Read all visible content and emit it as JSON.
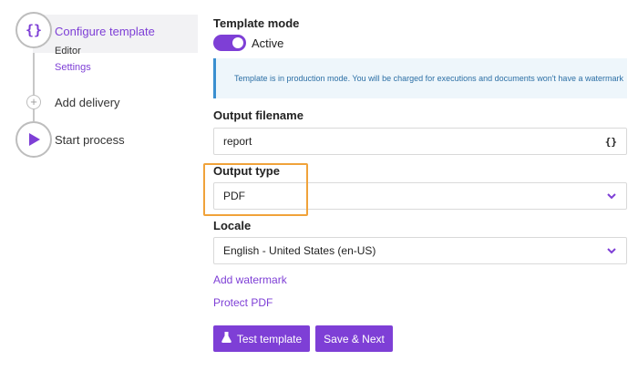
{
  "stepper": {
    "configure": {
      "icon": "{}",
      "label": "Configure template"
    },
    "sub_items": [
      {
        "label": "Editor",
        "active": false
      },
      {
        "label": "Settings",
        "active": true
      }
    ],
    "add_delivery": {
      "icon": "+",
      "label": "Add delivery"
    },
    "start_process": {
      "label": "Start process"
    }
  },
  "template_mode": {
    "title": "Template mode",
    "toggle_label": "Active",
    "enabled": true
  },
  "info_message": "Template is in production mode. You will be charged for executions and documents won't have a watermark",
  "output_filename": {
    "label": "Output filename",
    "value": "report",
    "icon": "{}"
  },
  "output_type": {
    "label": "Output type",
    "value": "PDF"
  },
  "locale": {
    "label": "Locale",
    "value": "English - United States (en-US)"
  },
  "links": {
    "add_watermark": "Add watermark",
    "protect_pdf": "Protect PDF"
  },
  "buttons": {
    "test_template": "Test template",
    "save_next": "Save & Next"
  },
  "colors": {
    "accent": "#7e3fd6",
    "info_border": "#3a8fd0",
    "highlight": "#f0a23a"
  }
}
